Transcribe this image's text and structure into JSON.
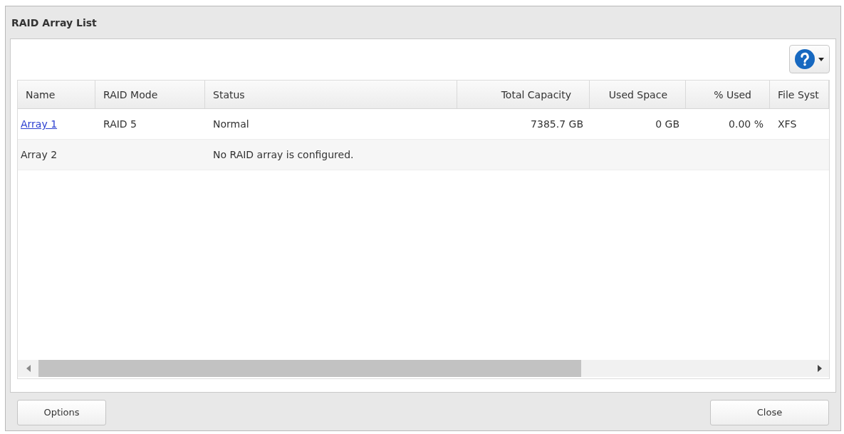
{
  "window": {
    "title": "RAID Array List"
  },
  "table": {
    "columns": [
      "Name",
      "RAID Mode",
      "Status",
      "Total Capacity",
      "Used Space",
      "% Used",
      "File Syst"
    ],
    "rows": [
      {
        "name": "Array 1",
        "link": true,
        "raid_mode": "RAID 5",
        "status": "Normal",
        "total_capacity": "7385.7 GB",
        "used_space": "0 GB",
        "percent_used": "0.00 %",
        "file_system": "XFS"
      },
      {
        "name": "Array 2",
        "link": false,
        "status": "No RAID array is configured."
      }
    ]
  },
  "footer": {
    "left_button": "Options",
    "right_button": "Close"
  }
}
